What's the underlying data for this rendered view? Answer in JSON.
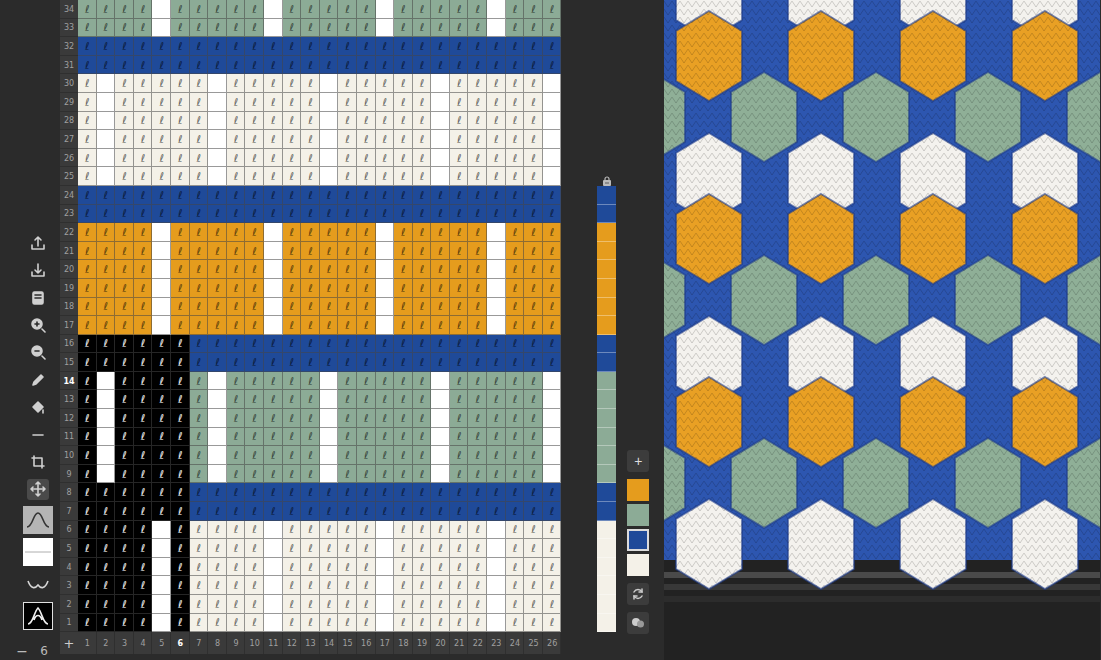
{
  "stitch_symbol": "ℓ",
  "cell_codes": [
    {
      "code": "C",
      "color": "#f4f1e8",
      "symbol": true
    },
    {
      "code": "W",
      "color": "#ffffff",
      "symbol": false
    },
    {
      "code": "B",
      "color": "#1f4a99",
      "symbol": true
    },
    {
      "code": "G",
      "color": "#8cab96",
      "symbol": true
    },
    {
      "code": "Y",
      "color": "#e59c1d",
      "symbol": true
    },
    {
      "code": "K",
      "color": "#000000",
      "symbol": true
    }
  ],
  "tools": [
    {
      "selected": false
    },
    {
      "selected": false
    },
    {
      "selected": false
    },
    {
      "selected": false
    },
    {
      "selected": false
    },
    {
      "selected": false
    },
    {
      "selected": false
    },
    {
      "selected": false
    },
    {
      "selected": false
    },
    {
      "selected": true
    }
  ],
  "stitch_types": [
    {
      "selected": false
    },
    {
      "selected": false
    },
    {
      "selected": false
    },
    {
      "selected": true
    }
  ],
  "zoom_control": {
    "minus": "−",
    "value": "6",
    "plus": "+"
  },
  "rows": [
    {
      "label": "34",
      "selected": false,
      "yarn": "G",
      "in_repeat": false,
      "cells": "GGGGWGGGGGWGGGGGWGGGGGWGGG"
    },
    {
      "label": "33",
      "selected": false,
      "yarn": "G",
      "in_repeat": false,
      "cells": "GGGGWGGGGGWGGGGGWGGGGGWGGG"
    },
    {
      "label": "32",
      "selected": false,
      "yarn": "B",
      "in_repeat": false,
      "cells": "BBBBBBBBBBBBBBBBBBBBBBBBBB"
    },
    {
      "label": "31",
      "selected": false,
      "yarn": "B",
      "in_repeat": false,
      "cells": "BBBBBBBBBBBBBBBBBBBBBBBBBB"
    },
    {
      "label": "30",
      "selected": false,
      "yarn": "C",
      "in_repeat": false,
      "cells": "CWCCCCCWCCCCCWCCCCCWCCCCCW"
    },
    {
      "label": "29",
      "selected": false,
      "yarn": "C",
      "in_repeat": false,
      "cells": "CWCCCCCWCCCCCWCCCCCWCCCCCW"
    },
    {
      "label": "28",
      "selected": false,
      "yarn": "C",
      "in_repeat": false,
      "cells": "CWCCCCCWCCCCCWCCCCCWCCCCCW"
    },
    {
      "label": "27",
      "selected": false,
      "yarn": "C",
      "in_repeat": false,
      "cells": "CWCCCCCWCCCCCWCCCCCWCCCCCW"
    },
    {
      "label": "26",
      "selected": false,
      "yarn": "C",
      "in_repeat": false,
      "cells": "CWCCCCCWCCCCCWCCCCCWCCCCCW"
    },
    {
      "label": "25",
      "selected": false,
      "yarn": "C",
      "in_repeat": false,
      "cells": "CWCCCCCWCCCCCWCCCCCWCCCCCW"
    },
    {
      "label": "24",
      "selected": false,
      "yarn": "B",
      "in_repeat": true,
      "cells": "BBBBBBBBBBBBBBBBBBBBBBBBBB"
    },
    {
      "label": "23",
      "selected": false,
      "yarn": "B",
      "in_repeat": true,
      "cells": "BBBBBBBBBBBBBBBBBBBBBBBBBB"
    },
    {
      "label": "22",
      "selected": false,
      "yarn": "Y",
      "in_repeat": true,
      "cells": "YYYYWYYYYYWYYYYYWYYYYYWYYY"
    },
    {
      "label": "21",
      "selected": false,
      "yarn": "Y",
      "in_repeat": true,
      "cells": "YYYYWYYYYYWYYYYYWYYYYYWYYY"
    },
    {
      "label": "20",
      "selected": false,
      "yarn": "Y",
      "in_repeat": true,
      "cells": "YYYYWYYYYYWYYYYYWYYYYYWYYY"
    },
    {
      "label": "19",
      "selected": false,
      "yarn": "Y",
      "in_repeat": true,
      "cells": "YYYYWYYYYYWYYYYYWYYYYYWYYY"
    },
    {
      "label": "18",
      "selected": false,
      "yarn": "Y",
      "in_repeat": true,
      "cells": "YYYYWYYYYYWYYYYYWYYYYYWYYY"
    },
    {
      "label": "17",
      "selected": false,
      "yarn": "Y",
      "in_repeat": true,
      "cells": "YYYYWYYYYYWYYYYYWYYYYYWYYY"
    },
    {
      "label": "16",
      "selected": false,
      "yarn": "B",
      "in_repeat": true,
      "cells": "KKKKKKBBBBBBBBBBBBBBBBBBBB"
    },
    {
      "label": "15",
      "selected": false,
      "yarn": "B",
      "in_repeat": true,
      "cells": "KKKKKKBBBBBBBBBBBBBBBBBBBB"
    },
    {
      "label": "14",
      "selected": true,
      "yarn": "G",
      "in_repeat": true,
      "cells": "KWKKKKGWGGGGGWGGGGGWGGGGGW"
    },
    {
      "label": "13",
      "selected": false,
      "yarn": "G",
      "in_repeat": true,
      "cells": "KWKKKKGWGGGGGWGGGGGWGGGGGW"
    },
    {
      "label": "12",
      "selected": false,
      "yarn": "G",
      "in_repeat": true,
      "cells": "KWKKKKGWGGGGGWGGGGGWGGGGGW"
    },
    {
      "label": "11",
      "selected": false,
      "yarn": "G",
      "in_repeat": true,
      "cells": "KWKKKKGWGGGGGWGGGGGWGGGGGW"
    },
    {
      "label": "10",
      "selected": false,
      "yarn": "G",
      "in_repeat": true,
      "cells": "KWKKKKGWGGGGGWGGGGGWGGGGGW"
    },
    {
      "label": "9",
      "selected": false,
      "yarn": "G",
      "in_repeat": true,
      "cells": "KWKKKKGWGGGGGWGGGGGWGGGGGW"
    },
    {
      "label": "8",
      "selected": false,
      "yarn": "B",
      "in_repeat": true,
      "cells": "KKKKKKBBBBBBBBBBBBBBBBBBBB"
    },
    {
      "label": "7",
      "selected": false,
      "yarn": "B",
      "in_repeat": true,
      "cells": "KKKKKKBBBBBBBBBBBBBBBBBBBB"
    },
    {
      "label": "6",
      "selected": false,
      "yarn": "C",
      "in_repeat": true,
      "cells": "KKKKWKCCCCWCCCCCWCCCCCWCCC"
    },
    {
      "label": "5",
      "selected": false,
      "yarn": "C",
      "in_repeat": true,
      "cells": "KKKKWKCCCCWCCCCCWCCCCCWCCC"
    },
    {
      "label": "4",
      "selected": false,
      "yarn": "C",
      "in_repeat": true,
      "cells": "KKKKWKCCCCWCCCCCWCCCCCWCCC"
    },
    {
      "label": "3",
      "selected": false,
      "yarn": "C",
      "in_repeat": true,
      "cells": "KKKKWKCCCCWCCCCCWCCCCCWCCC"
    },
    {
      "label": "2",
      "selected": false,
      "yarn": "C",
      "in_repeat": true,
      "cells": "KKKKWKCCCCWCCCCCWCCCCCWCCC"
    },
    {
      "label": "1",
      "selected": false,
      "yarn": "C",
      "in_repeat": true,
      "cells": "KKKKWKCCCCWCCCCCWCCCCCWCCC"
    }
  ],
  "columns": [
    {
      "label": "1",
      "selected": false
    },
    {
      "label": "2",
      "selected": false
    },
    {
      "label": "3",
      "selected": false
    },
    {
      "label": "4",
      "selected": false
    },
    {
      "label": "5",
      "selected": false
    },
    {
      "label": "6",
      "selected": true
    },
    {
      "label": "7",
      "selected": false
    },
    {
      "label": "8",
      "selected": false
    },
    {
      "label": "9",
      "selected": false
    },
    {
      "label": "10",
      "selected": false
    },
    {
      "label": "11",
      "selected": false
    },
    {
      "label": "12",
      "selected": false
    },
    {
      "label": "13",
      "selected": false
    },
    {
      "label": "14",
      "selected": false
    },
    {
      "label": "15",
      "selected": false
    },
    {
      "label": "16",
      "selected": false
    },
    {
      "label": "17",
      "selected": false
    },
    {
      "label": "18",
      "selected": false
    },
    {
      "label": "19",
      "selected": false
    },
    {
      "label": "20",
      "selected": false
    },
    {
      "label": "21",
      "selected": false
    },
    {
      "label": "22",
      "selected": false
    },
    {
      "label": "23",
      "selected": false
    },
    {
      "label": "24",
      "selected": false
    },
    {
      "label": "25",
      "selected": false
    },
    {
      "label": "26",
      "selected": false
    }
  ],
  "palette": {
    "add_button": "+",
    "swatches": [
      {
        "color": "#e59c1d",
        "selected": false
      },
      {
        "color": "#8cab96",
        "selected": false
      },
      {
        "color": "#1f4a99",
        "selected": true
      },
      {
        "color": "#f4f1e8",
        "selected": false
      }
    ]
  },
  "preview": {
    "rows": [
      {
        "color": "#f4f2ee"
      },
      {
        "color": "#e9a024"
      },
      {
        "color": "#8faf97"
      },
      {
        "color": "#f4f2ee"
      },
      {
        "color": "#e9a024"
      },
      {
        "color": "#8faf97"
      },
      {
        "color": "#f4f2ee"
      },
      {
        "color": "#e9a024"
      },
      {
        "color": "#8faf97"
      },
      {
        "color": "#f4f2ee"
      }
    ]
  }
}
